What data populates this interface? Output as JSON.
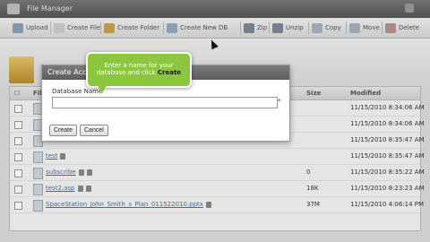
{
  "window": {
    "title": "File Manager"
  },
  "toolbar": {
    "items": [
      {
        "label": "Upload",
        "icon": "upload-icon"
      },
      {
        "label": "Create File",
        "icon": "new-file-icon"
      },
      {
        "label": "Create Folder",
        "icon": "new-folder-icon"
      },
      {
        "label": "Create New DB",
        "icon": "database-icon"
      },
      {
        "label": "Zip",
        "icon": "zip-icon"
      },
      {
        "label": "Unzip",
        "icon": "unzip-icon"
      },
      {
        "label": "Copy",
        "icon": "copy-icon"
      },
      {
        "label": "Move",
        "icon": "move-icon"
      },
      {
        "label": "Delete",
        "icon": "delete-icon"
      }
    ]
  },
  "grid": {
    "columns": {
      "name": "File",
      "size": "Size",
      "modified": "Modified"
    },
    "rows": [
      {
        "name": "",
        "size": "",
        "modified": "11/15/2010 8:34:06 AM"
      },
      {
        "name": "",
        "size": "",
        "modified": "11/15/2010 8:34:06 AM"
      },
      {
        "name": "",
        "size": "",
        "modified": "11/15/2010 8:35:47 AM"
      },
      {
        "name": "test",
        "size": "",
        "modified": "11/15/2010 8:35:47 AM"
      },
      {
        "name": "subscribe",
        "size": "0",
        "modified": "11/15/2010 8:35:22 AM"
      },
      {
        "name": "test2.asp",
        "size": "18K",
        "modified": "11/15/2010 8:23:23 AM"
      },
      {
        "name": "SpaceStation_John_Smith_s_Plan_011522010.pptx",
        "size": "37M",
        "modified": "11/15/2010 4:06:14 PM"
      }
    ]
  },
  "dialog": {
    "title": "Create Access Database",
    "field_label": "Database Name",
    "field_value": "",
    "required_mark": "*",
    "create_label": "Create",
    "cancel_label": "Cancel"
  },
  "tooltip": {
    "line1": "Enter a name for your",
    "line2_prefix": "database and click ",
    "line2_bold": "Create"
  },
  "colors": {
    "tooltip_green": "#8cc63f",
    "title_bar": "#5c5c5c",
    "link": "#4a6fa5"
  }
}
